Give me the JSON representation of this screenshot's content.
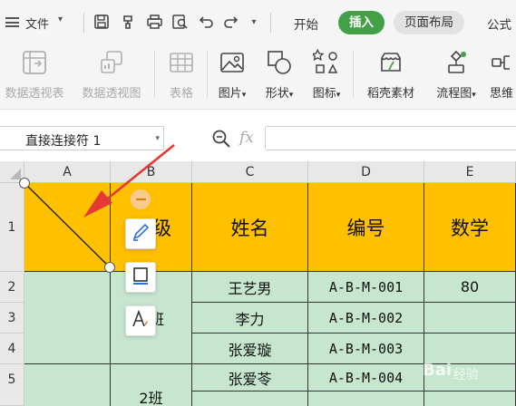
{
  "menubar": {
    "file_label": "文件",
    "tabs": [
      {
        "label": "开始"
      },
      {
        "label": "插入",
        "active": true
      },
      {
        "label": "页面布局"
      },
      {
        "label": "公式"
      }
    ],
    "quick_access_icons": [
      "save-icon",
      "format-painter-icon",
      "print-icon",
      "print-preview-icon",
      "undo-icon",
      "redo-icon"
    ]
  },
  "ribbon": {
    "items": [
      {
        "label": "数据透视表",
        "icon": "pivot-table-icon",
        "enabled": false
      },
      {
        "label": "数据透视图",
        "icon": "pivot-chart-icon",
        "enabled": false
      },
      {
        "label": "表格",
        "icon": "table-icon",
        "enabled": false
      },
      {
        "label": "图片",
        "icon": "picture-icon",
        "dropdown": true
      },
      {
        "label": "形状",
        "icon": "shape-icon",
        "dropdown": true
      },
      {
        "label": "图标",
        "icon": "icons-icon",
        "dropdown": true
      },
      {
        "label": "稻壳素材",
        "icon": "docer-material-icon"
      },
      {
        "label": "流程图",
        "icon": "flowchart-icon",
        "dropdown": true
      },
      {
        "label": "思维",
        "icon": "mindmap-icon"
      }
    ]
  },
  "formula_bar": {
    "name_box": "直接连接符 1",
    "fx_label": "fx",
    "formula_value": ""
  },
  "grid": {
    "columns": [
      "A",
      "B",
      "C",
      "D",
      "E"
    ],
    "rows": [
      "1",
      "2",
      "3",
      "4",
      "5"
    ],
    "header_row": {
      "B": "级",
      "C": "姓名",
      "D": "编号",
      "E": "数学"
    },
    "data": [
      {
        "name": "王艺男",
        "id": "A-B-M-001",
        "math": "80"
      },
      {
        "name": "李力",
        "id": "A-B-M-002",
        "math": ""
      },
      {
        "name": "张爱璇",
        "id": "A-B-M-003",
        "math": ""
      },
      {
        "name": "张爱苓",
        "id": "A-B-M-004",
        "math": ""
      }
    ],
    "class_labels": [
      "班",
      "2班"
    ]
  },
  "colors": {
    "header_fill": "#ffc000",
    "data_fill": "#c6e6cf",
    "active_tab": "#43a047",
    "annotation_arrow": "#e53935"
  },
  "watermark": {
    "brand": "Bai",
    "suffix": "经验"
  }
}
